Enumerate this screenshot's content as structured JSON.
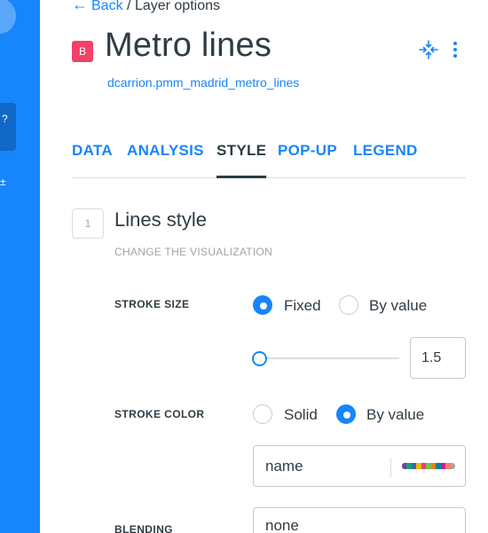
{
  "header": {
    "back_label": "Back",
    "separator": "/",
    "crumb": "Layer options",
    "badge": "B",
    "title": "Metro lines",
    "subtitle": "dcarrion.pmm_madrid_metro_lines"
  },
  "tabs": [
    {
      "label": "DATA",
      "active": false
    },
    {
      "label": "ANALYSIS",
      "active": false
    },
    {
      "label": "STYLE",
      "active": true
    },
    {
      "label": "POP-UP",
      "active": false
    },
    {
      "label": "LEGEND",
      "active": false
    }
  ],
  "section": {
    "number": "1",
    "title": "Lines style",
    "subtitle": "CHANGE THE VISUALIZATION"
  },
  "stroke_size": {
    "label": "STROKE SIZE",
    "options": [
      {
        "label": "Fixed",
        "checked": true
      },
      {
        "label": "By value",
        "checked": false
      }
    ],
    "value": "1.5",
    "slider_fraction": 0.0
  },
  "stroke_color": {
    "label": "STROKE COLOR",
    "options": [
      {
        "label": "Solid",
        "checked": false
      },
      {
        "label": "By value",
        "checked": true
      }
    ],
    "field": "name",
    "ramp_colors": [
      "#7f3c8d",
      "#11a579",
      "#3969ac",
      "#f2b701",
      "#e73f74",
      "#80ba5a",
      "#e68310",
      "#008695",
      "#cf1c90",
      "#f97b72",
      "#a5aa99"
    ]
  },
  "blending": {
    "label": "BLENDING",
    "value": "none"
  },
  "colors": {
    "accent": "#1785fb",
    "badge": "#f34167",
    "text": "#2e3c43",
    "muted": "#9ea5a9"
  },
  "icons": {
    "back": "arrow-left-icon",
    "collapse": "collapse-arrows-icon",
    "menu": "vertical-dots-icon"
  }
}
